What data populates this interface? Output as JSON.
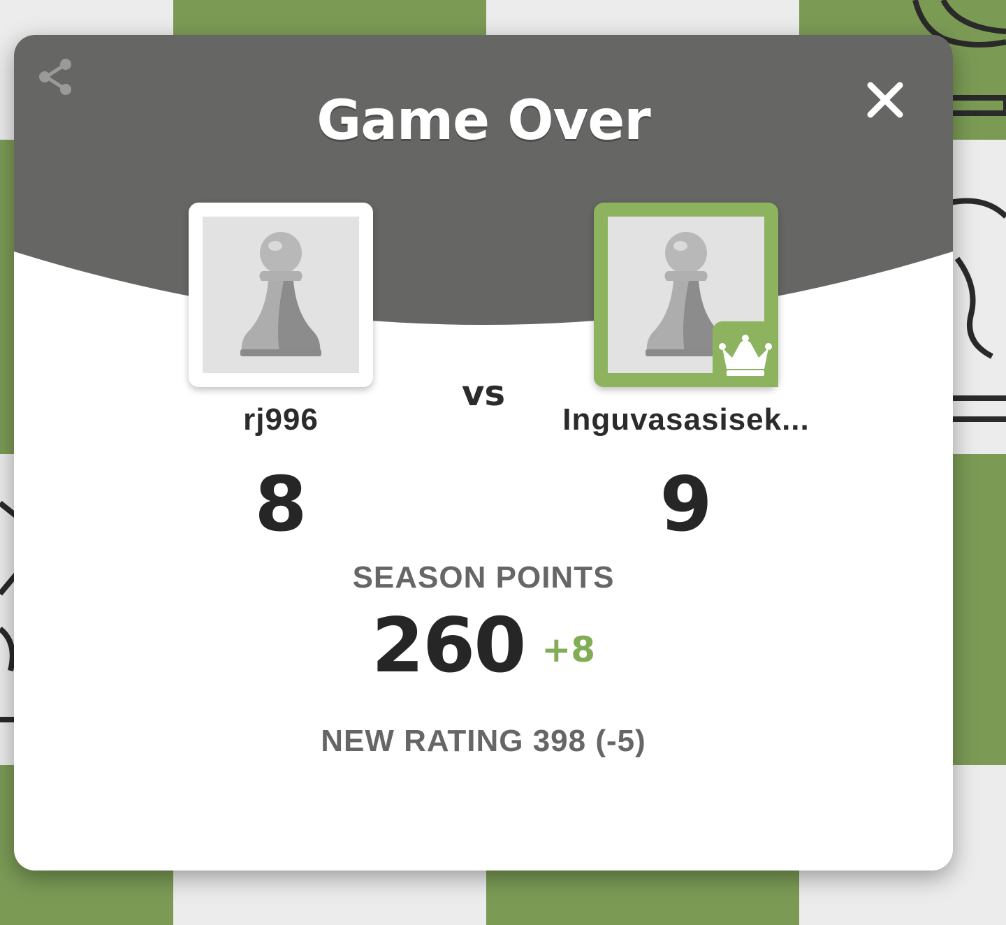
{
  "modal": {
    "title": "Game Over",
    "share_icon": "share-icon",
    "close_icon": "close-icon"
  },
  "players": {
    "left": {
      "name": "rj996",
      "score": "8",
      "avatar_icon": "pawn-icon"
    },
    "right": {
      "name": "Inguvasasisek...",
      "score": "9",
      "avatar_icon": "pawn-icon",
      "winner_icon": "crown-icon"
    },
    "vs_label": "vs"
  },
  "season": {
    "label": "SEASON POINTS",
    "points": "260",
    "delta": "+8"
  },
  "rating": {
    "text": "NEW RATING 398 (-5)"
  },
  "colors": {
    "board_green": "#7b9b55",
    "board_light": "#ececec",
    "header_gray": "#666665",
    "winner_green": "#8db35f",
    "delta_green": "#82ad55"
  }
}
